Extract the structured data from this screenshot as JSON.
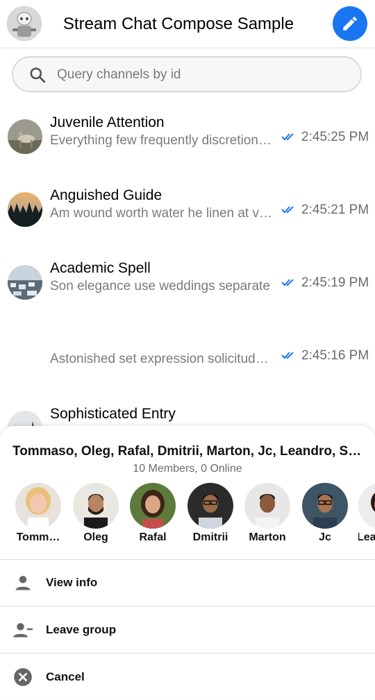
{
  "header": {
    "title": "Stream Chat Compose Sample",
    "avatar_icon": "robot-avatar",
    "compose_icon": "pencil-icon",
    "accent": "#1976f0"
  },
  "search": {
    "placeholder": "Query channels by id",
    "icon": "search-icon"
  },
  "channels": [
    {
      "name": "Juvenile Attention",
      "message": "Everything few frequently discretion …",
      "time": "2:45:25 PM",
      "read": true
    },
    {
      "name": "Anguished Guide",
      "message": "Am wound worth water he linen at ve…",
      "time": "2:45:21 PM",
      "read": true
    },
    {
      "name": "Academic Spell",
      "message": "Son elegance use weddings separate",
      "time": "2:45:19 PM",
      "read": true
    },
    {
      "name": "",
      "message": "Astonished set expression solicitude…",
      "time": "2:45:16 PM",
      "read": true
    },
    {
      "name": "Sophisticated Entry",
      "message": "",
      "time": "",
      "read": false
    }
  ],
  "sheet": {
    "title": "Tommaso, Oleg, Rafal, Dmitrii, Marton, Jc, Leandro, Sam…",
    "subtitle": "10 Members, 0 Online",
    "members": [
      {
        "name": "Tomm…"
      },
      {
        "name": "Oleg"
      },
      {
        "name": "Rafal"
      },
      {
        "name": "Dmitrii"
      },
      {
        "name": "Marton"
      },
      {
        "name": "Jc"
      },
      {
        "name": "Lea"
      }
    ],
    "actions": [
      {
        "label": "View info",
        "icon": "person-icon"
      },
      {
        "label": "Leave group",
        "icon": "person-remove-icon"
      },
      {
        "label": "Cancel",
        "icon": "cancel-icon"
      }
    ]
  }
}
